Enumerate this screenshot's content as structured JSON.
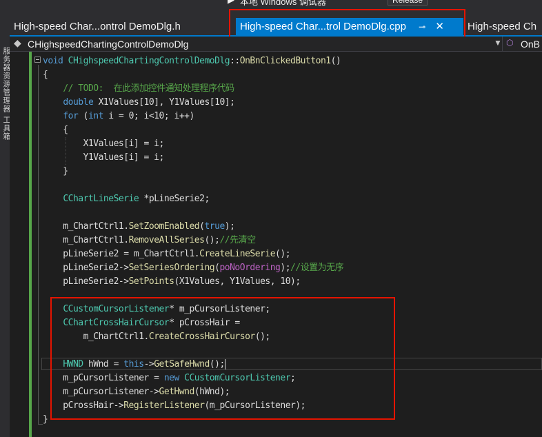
{
  "toolbar": {
    "debugger_label": "本地 Windows 调试器",
    "config_label": "Release"
  },
  "sidebar": {
    "labels": [
      "服务器资源管理器",
      "工具箱"
    ]
  },
  "tabs": [
    {
      "label": "High-speed Char...ontrol DemoDlg.h",
      "active": false
    },
    {
      "label": "High-speed Char...trol DemoDlg.cpp",
      "active": true,
      "pin_glyph": "⊸",
      "close_glyph": "✕"
    },
    {
      "label": "High-speed Ch",
      "active": false
    }
  ],
  "navbar": {
    "class_selector": "CHighspeedChartingControlDemoDlg",
    "member_selector": "OnB"
  },
  "colors": {
    "accent": "#007acc",
    "highlight_box": "#e51400",
    "change_bar": "#57a64a"
  },
  "editor": {
    "lines": [
      [
        [
          "kw",
          "void "
        ],
        [
          "cl",
          "CHighspeedChartingControlDemoDlg"
        ],
        [
          "pl",
          "::"
        ],
        [
          "fn",
          "OnBnClickedButton1"
        ],
        [
          "pl",
          "()"
        ]
      ],
      [
        [
          "pl",
          "{"
        ]
      ],
      [
        [
          "pl",
          "    "
        ],
        [
          "cm",
          "// TODO:  在此添加控件通知处理程序代码"
        ]
      ],
      [
        [
          "pl",
          "    "
        ],
        [
          "kw",
          "double"
        ],
        [
          "pl",
          " X1Values[10], Y1Values[10];"
        ]
      ],
      [
        [
          "pl",
          "    "
        ],
        [
          "kw",
          "for"
        ],
        [
          "pl",
          " ("
        ],
        [
          "kw",
          "int"
        ],
        [
          "pl",
          " i = 0; i<10; i++)"
        ]
      ],
      [
        [
          "pl",
          "    {"
        ]
      ],
      [
        [
          "pl",
          "        X1Values[i] = i;"
        ]
      ],
      [
        [
          "pl",
          "        Y1Values[i] = i;"
        ]
      ],
      [
        [
          "pl",
          "    }"
        ]
      ],
      [
        [
          "pl",
          ""
        ]
      ],
      [
        [
          "pl",
          "    "
        ],
        [
          "cl",
          "CChartLineSerie"
        ],
        [
          "pl",
          " *pLineSerie2;"
        ]
      ],
      [
        [
          "pl",
          ""
        ]
      ],
      [
        [
          "pl",
          "    m_ChartCtrl1."
        ],
        [
          "fn",
          "SetZoomEnabled"
        ],
        [
          "pl",
          "("
        ],
        [
          "kw",
          "true"
        ],
        [
          "pl",
          ");"
        ]
      ],
      [
        [
          "pl",
          "    m_ChartCtrl1."
        ],
        [
          "fn",
          "RemoveAllSeries"
        ],
        [
          "pl",
          "();"
        ],
        [
          "cm",
          "//先清空"
        ]
      ],
      [
        [
          "pl",
          "    pLineSerie2 = m_ChartCtrl1."
        ],
        [
          "fn",
          "CreateLineSerie"
        ],
        [
          "pl",
          "();"
        ]
      ],
      [
        [
          "pl",
          "    pLineSerie2->"
        ],
        [
          "fn",
          "SetSeriesOrdering"
        ],
        [
          "pl",
          "("
        ],
        [
          "mc",
          "poNoOrdering"
        ],
        [
          "pl",
          ");"
        ],
        [
          "cm",
          "//设置为无序"
        ]
      ],
      [
        [
          "pl",
          "    pLineSerie2->"
        ],
        [
          "fn",
          "SetPoints"
        ],
        [
          "pl",
          "(X1Values, Y1Values, 10);"
        ]
      ],
      [
        [
          "pl",
          ""
        ]
      ],
      [
        [
          "pl",
          "    "
        ],
        [
          "cl",
          "CCustomCursorListener"
        ],
        [
          "pl",
          "* m_pCursorListener;"
        ]
      ],
      [
        [
          "pl",
          "    "
        ],
        [
          "cl",
          "CChartCrossHairCursor"
        ],
        [
          "pl",
          "* pCrossHair ="
        ]
      ],
      [
        [
          "pl",
          "        m_ChartCtrl1."
        ],
        [
          "fn",
          "CreateCrossHairCursor"
        ],
        [
          "pl",
          "();"
        ]
      ],
      [
        [
          "pl",
          ""
        ]
      ],
      [
        [
          "pl",
          "    "
        ],
        [
          "cl",
          "HWND"
        ],
        [
          "pl",
          " hWnd = "
        ],
        [
          "kw",
          "this"
        ],
        [
          "pl",
          "->"
        ],
        [
          "fn",
          "GetSafeHwnd"
        ],
        [
          "pl",
          "();"
        ],
        [
          "caret",
          ""
        ]
      ],
      [
        [
          "pl",
          "    m_pCursorListener = "
        ],
        [
          "kw",
          "new"
        ],
        [
          "pl",
          " "
        ],
        [
          "cl",
          "CCustomCursorListener"
        ],
        [
          "pl",
          ";"
        ]
      ],
      [
        [
          "pl",
          "    m_pCursorListener->"
        ],
        [
          "fn",
          "GetHwnd"
        ],
        [
          "pl",
          "(hWnd);"
        ]
      ],
      [
        [
          "pl",
          "    pCrossHair->"
        ],
        [
          "fn",
          "RegisterListener"
        ],
        [
          "pl",
          "(m_pCursorListener);"
        ]
      ],
      [
        [
          "pl",
          "}"
        ]
      ]
    ]
  }
}
